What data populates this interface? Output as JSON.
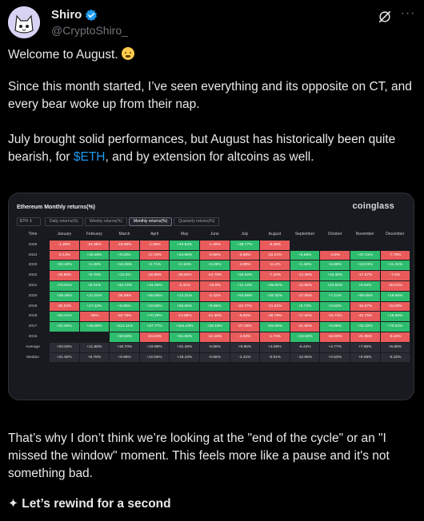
{
  "author": {
    "display_name": "Shiro",
    "handle": "@CryptoShiro_"
  },
  "icons": {
    "verified": "verified-badge-icon",
    "grok": "grok-icon",
    "more": "more-options-icon",
    "emoji": "face-emoji-icon"
  },
  "colors": {
    "accent": "#1d9bf0",
    "positive": "#2ebd6e",
    "negative": "#e95b5b"
  },
  "tweet": {
    "p1": "Welcome to August.",
    "p2": "Since this month started, I’ve seen everything and its opposite on CT, and every bear woke up from their nap.",
    "p3_before": "July brought solid performances, but August has historically been quite bearish, for ",
    "p3_cashtag": "$ETH",
    "p3_after": ", and by extension for altcoins as well.",
    "p4": "That’s why I don’t think we’re looking at the \"end of the cycle\" or an \"I missed the window\" moment. This feels more like a pause and it's not something bad.",
    "p5": "✦ Let’s rewind for a second"
  },
  "card": {
    "title": "Ethereum Monthly returns(%)",
    "brand": "coinglass",
    "asset": "ETH",
    "tabs": [
      "Daily returns(%)",
      "Weekly returns(%)",
      "Monthly returns(%)",
      "Quarterly returns(%)"
    ],
    "active_tab": 2,
    "table": {
      "header": [
        "Time",
        "January",
        "February",
        "March",
        "April",
        "May",
        "June",
        "July",
        "August",
        "September",
        "October",
        "November",
        "December"
      ],
      "rows": [
        {
          "label": "2025",
          "values": [
            "-1.28%",
            "-31.95%",
            "-18.69%",
            "-1.56%",
            "+40.84%",
            "-1.49%",
            "+48.77%",
            "-6.48%",
            "",
            "",
            "",
            ""
          ]
        },
        {
          "label": "2024",
          "values": [
            "-0.13%",
            "+46.28%",
            "+9.33%",
            "-17.29%",
            "+24.65%",
            "-8.68%",
            "-5.88%",
            "-22.21%",
            "+3.56%",
            "-3.6%",
            "+47.31%",
            "-7.76%"
          ]
        },
        {
          "label": "2023",
          "values": [
            "+32.44%",
            "+1.26%",
            "+13.46%",
            "+2.71%",
            "+0.16%",
            "+3.29%",
            "-3.99%",
            "-11.2%",
            "+1.46%",
            "+8.69%",
            "+13.01%",
            "+11.31%"
          ]
        },
        {
          "label": "2022",
          "values": [
            "-26.89%",
            "+8.78%",
            "+12.2%",
            "-16.88%",
            "-28.84%",
            "-44.79%",
            "+56.62%",
            "-7.33%",
            "-14.49%",
            "+18.39%",
            "-17.67%",
            "-7.6%"
          ]
        },
        {
          "label": "2021",
          "values": [
            "+78.51%",
            "+8.41%",
            "+34.74%",
            "+44.29%",
            "-2.31%",
            "-15.9%",
            "+11.14%",
            "+35.62%",
            "-12.55%",
            "+42.92%",
            "+8.04%",
            "-20.61%"
          ]
        },
        {
          "label": "2020",
          "values": [
            "+39.28%",
            "+21.01%",
            "-38.98%",
            "+55.06%",
            "+12.21%",
            "-2.42%",
            "+53.56%",
            "+25.32%",
            "-17.08%",
            "+7.21%",
            "+59.45%",
            "+19.66%"
          ]
        },
        {
          "label": "2019",
          "values": [
            "-20.23%",
            "+27.22%",
            "+6.05%",
            "+18.58%",
            "+56.65%",
            "+8.86%",
            "-24.77%",
            "-21.31%",
            "+5.72%",
            "+0.53%",
            "-16.67%",
            "-15.09%"
          ]
        },
        {
          "label": "2018",
          "values": [
            "+52.01%",
            "-26%",
            "-53.79%",
            "+70.29%",
            "-13.96%",
            "-21.36%",
            "-6.82%",
            "-36.79%",
            "-17.32%",
            "-16.71%",
            "-42.79%",
            "+19.68%"
          ]
        },
        {
          "label": "2017",
          "values": [
            "+31.92%",
            "+48.09%",
            "+214.11%",
            "+67.77%",
            "+161.43%",
            "+26.19%",
            "-27.29%",
            "+92.06%",
            "-21.65%",
            "+0.08%",
            "+42.32%",
            "+70.54%"
          ]
        },
        {
          "label": "2016",
          "values": [
            "",
            "",
            "+10.58%",
            "-23.18%",
            "+61.95%",
            "-12.18%",
            "-4.83%",
            "-1.74%",
            "+16.53%",
            "-16.03%",
            "-21.95%",
            "-6.32%"
          ]
        }
      ],
      "average": {
        "label": "Average",
        "values": [
          "+20.63%",
          "+11.68%",
          "+18.70%",
          "+19.98%",
          "+31.28%",
          "-6.85%",
          "+9.85%",
          "+4.86%",
          "-6.42%",
          "+4.77%",
          "+7.86%",
          "+6.85%"
        ]
      },
      "median": {
        "label": "Median",
        "values": [
          "+31.92%",
          "+8.78%",
          "+9.96%",
          "+10.66%",
          "+18.43%",
          "-5.55%",
          "-4.41%",
          "-6.91%",
          "-12.55%",
          "+0.53%",
          "+8.06%",
          "-6.32%"
        ]
      }
    }
  }
}
